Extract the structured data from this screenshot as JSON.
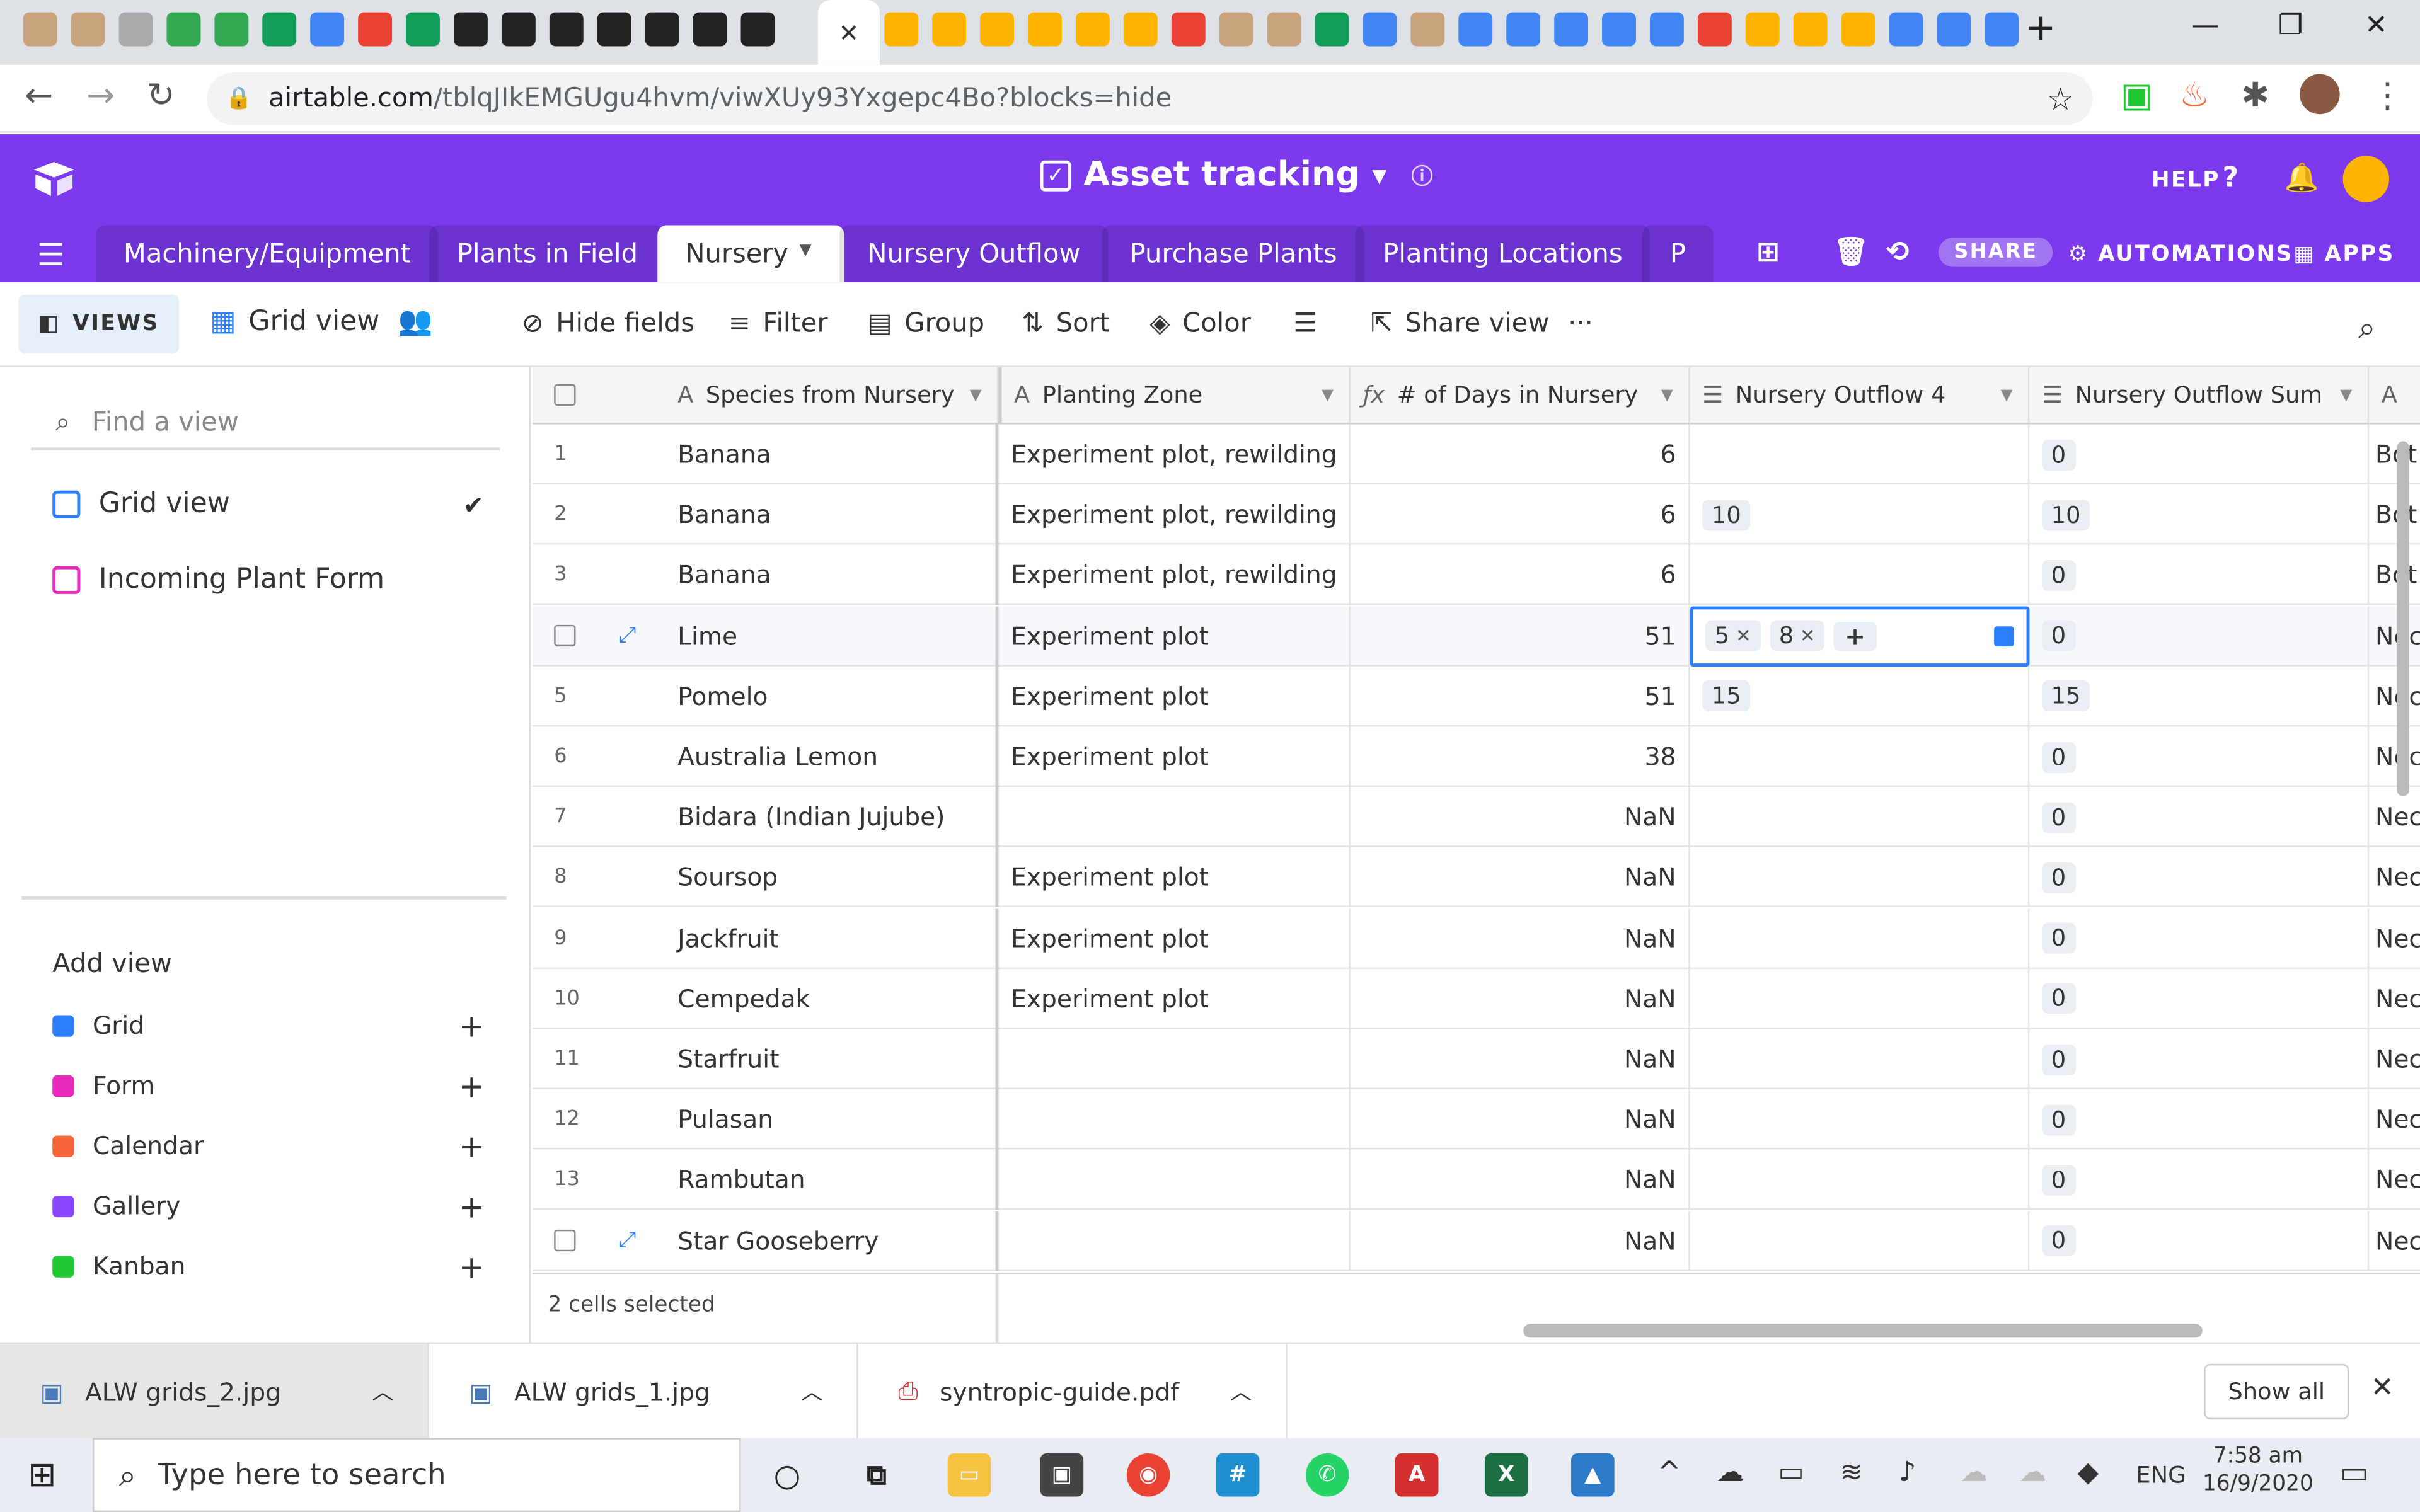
{
  "browser": {
    "url_host": "airtable.com",
    "url_path": "/tblqJIkEMGUgu4hvm/viwXUy93Yxgepc4Bo?blocks=hide",
    "active_tab_close": "✕",
    "new_tab": "+"
  },
  "app": {
    "base_title": "Asset tracking",
    "help_label": "HELP",
    "tabs": [
      "Machinery/Equipment",
      "Plants in Field",
      "Nursery",
      "Nursery Outflow",
      "Purchase Plants",
      "Planting Locations",
      "P"
    ],
    "share_label": "SHARE",
    "automations_label": "AUTOMATIONS",
    "apps_label": "APPS",
    "accent": "#7c39ed"
  },
  "toolbar": {
    "views_label": "VIEWS",
    "current_view": "Grid view",
    "hide_fields": "Hide fields",
    "filter": "Filter",
    "group": "Group",
    "sort": "Sort",
    "color": "Color",
    "share_view": "Share view",
    "more": "···"
  },
  "sidebar": {
    "find_placeholder": "Find a view",
    "views": [
      {
        "label": "Grid view",
        "color": "#2d7ff9"
      },
      {
        "label": "Incoming Plant Form",
        "color": "#e929ba"
      }
    ],
    "add_view_title": "Add view",
    "add_views": [
      {
        "label": "Grid",
        "color": "#2d7ff9"
      },
      {
        "label": "Form",
        "color": "#e929ba"
      },
      {
        "label": "Calendar",
        "color": "#f7653b"
      },
      {
        "label": "Gallery",
        "color": "#8b46ff"
      },
      {
        "label": "Kanban",
        "color": "#20c933"
      }
    ]
  },
  "grid": {
    "columns": [
      "Species from Nursery",
      "Planting Zone",
      "# of Days in Nursery",
      "Nursery Outflow 4",
      "Nursery Outflow Sum"
    ],
    "rows": [
      {
        "n": "1",
        "species": "Banana",
        "zone": "Experiment plot, rewilding",
        "days": "6",
        "outflow": [],
        "sum": "0",
        "extra": "Bot"
      },
      {
        "n": "2",
        "species": "Banana",
        "zone": "Experiment plot, rewilding",
        "days": "6",
        "outflow": [
          "10"
        ],
        "sum": "10",
        "extra": "Bot"
      },
      {
        "n": "3",
        "species": "Banana",
        "zone": "Experiment plot, rewilding",
        "days": "6",
        "outflow": [],
        "sum": "0",
        "extra": "Bot"
      },
      {
        "n": "",
        "species": "Lime",
        "zone": "Experiment plot",
        "days": "51",
        "outflow": [
          "5",
          "8"
        ],
        "sum": "0",
        "extra": "Nec"
      },
      {
        "n": "5",
        "species": "Pomelo",
        "zone": "Experiment plot",
        "days": "51",
        "outflow": [
          "15"
        ],
        "sum": "15",
        "extra": "Nec"
      },
      {
        "n": "6",
        "species": "Australia Lemon",
        "zone": "Experiment plot",
        "days": "38",
        "outflow": [],
        "sum": "0",
        "extra": "Nec"
      },
      {
        "n": "7",
        "species": "Bidara (Indian Jujube)",
        "zone": "",
        "days": "NaN",
        "outflow": [],
        "sum": "0",
        "extra": "Nec"
      },
      {
        "n": "8",
        "species": "Soursop",
        "zone": "Experiment plot",
        "days": "NaN",
        "outflow": [],
        "sum": "0",
        "extra": "Nec"
      },
      {
        "n": "9",
        "species": "Jackfruit",
        "zone": "Experiment plot",
        "days": "NaN",
        "outflow": [],
        "sum": "0",
        "extra": "Nec"
      },
      {
        "n": "10",
        "species": "Cempedak",
        "zone": "Experiment plot",
        "days": "NaN",
        "outflow": [],
        "sum": "0",
        "extra": "Nec"
      },
      {
        "n": "11",
        "species": "Starfruit",
        "zone": "",
        "days": "NaN",
        "outflow": [],
        "sum": "0",
        "extra": "Nec"
      },
      {
        "n": "12",
        "species": "Pulasan",
        "zone": "",
        "days": "NaN",
        "outflow": [],
        "sum": "0",
        "extra": "Nec"
      },
      {
        "n": "13",
        "species": "Rambutan",
        "zone": "",
        "days": "NaN",
        "outflow": [],
        "sum": "0",
        "extra": "Nec"
      },
      {
        "n": "",
        "species": "Star Gooseberry",
        "zone": "",
        "days": "NaN",
        "outflow": [],
        "sum": "0",
        "extra": "Nec"
      }
    ],
    "selection_status": "2 cells selected"
  },
  "downloads": {
    "items": [
      "ALW grids_2.jpg",
      "ALW grids_1.jpg",
      "syntropic-guide.pdf"
    ],
    "show_all": "Show all"
  },
  "taskbar": {
    "search_placeholder": "Type here to search",
    "language": "ENG",
    "time": "7:58 am",
    "date": "16/9/2020"
  }
}
